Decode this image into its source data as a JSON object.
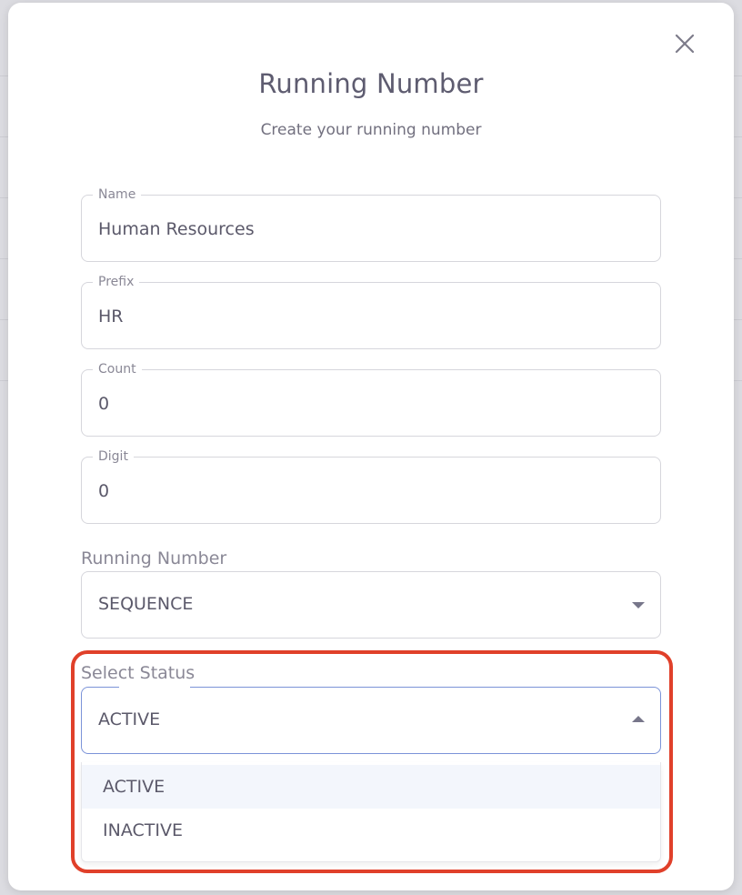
{
  "modal": {
    "title": "Running Number",
    "subtitle": "Create your running number",
    "close_label": "×"
  },
  "fields": {
    "name": {
      "label": "Name",
      "value": "Human Resources"
    },
    "prefix": {
      "label": "Prefix",
      "value": "HR"
    },
    "count": {
      "label": "Count",
      "value": "0"
    },
    "digit": {
      "label": "Digit",
      "value": "0"
    }
  },
  "running_number": {
    "caption": "Running Number",
    "selected": "SEQUENCE"
  },
  "status": {
    "caption": "Select Status",
    "selected": "ACTIVE",
    "options": [
      "ACTIVE",
      "INACTIVE"
    ]
  },
  "colors": {
    "highlight": "#e0402a",
    "focus_border": "#7b93d8",
    "selected_option_bg": "#f3f6fc"
  }
}
